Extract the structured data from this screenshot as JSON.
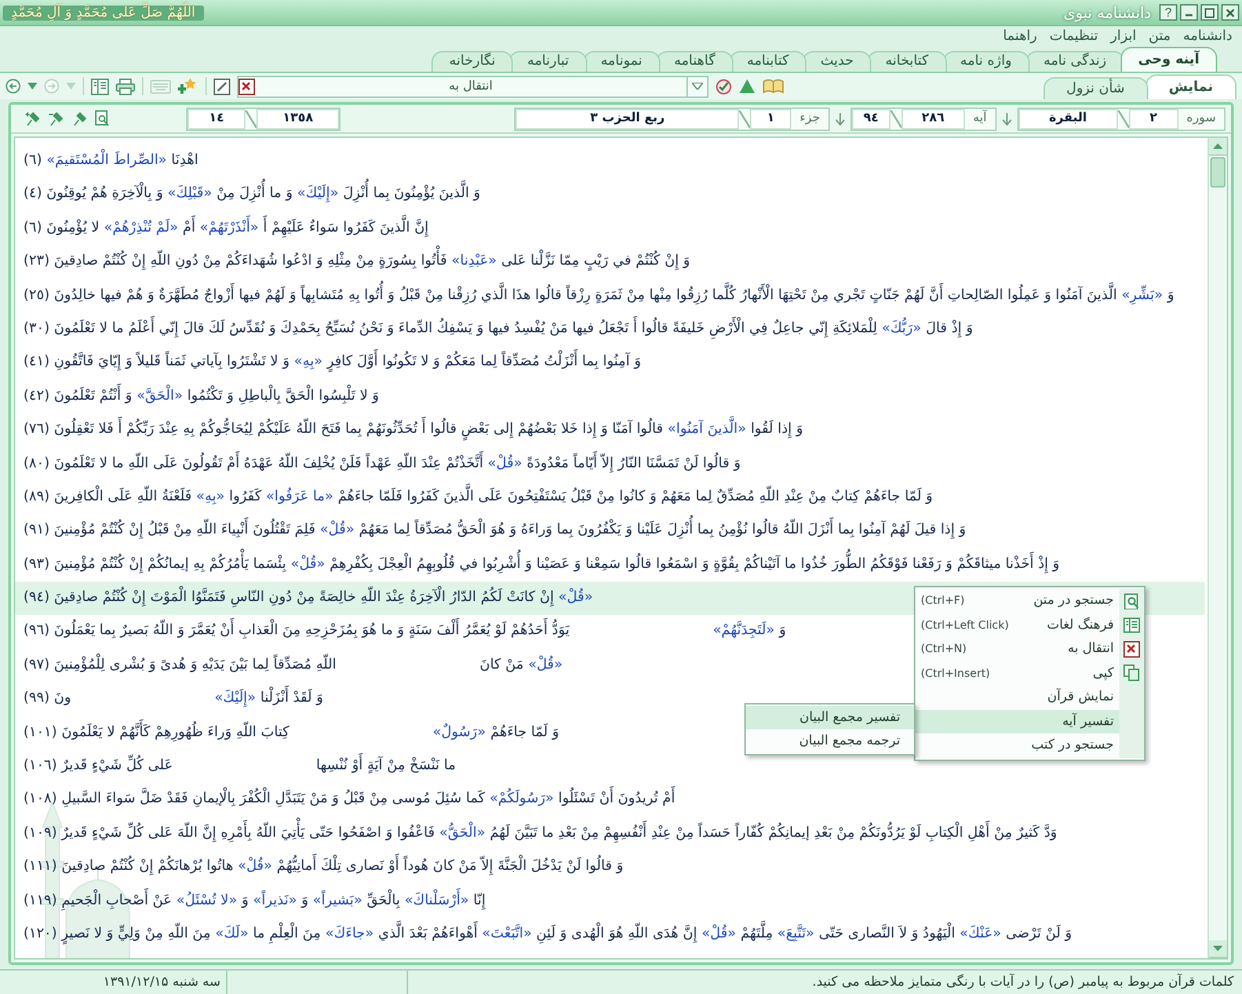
{
  "window": {
    "title": "دانشنامه نبوی",
    "calligraphy": "اللّهُمَّ صَلِّ عَلى مُحَمَّدٍ وَ آلِ مُحَمَّدٍ",
    "help_button": "?"
  },
  "menu": [
    "دانشنامه",
    "متن",
    "ابزار",
    "تنظیمات",
    "راهنما"
  ],
  "tabs": [
    {
      "label": "آینه وحی",
      "selected": true
    },
    {
      "label": "زندگی نامه",
      "selected": false
    },
    {
      "label": "واژه نامه",
      "selected": false
    },
    {
      "label": "کتابخانه",
      "selected": false
    },
    {
      "label": "حدیث",
      "selected": false
    },
    {
      "label": "کتابنامه",
      "selected": false
    },
    {
      "label": "گاهنامه",
      "selected": false
    },
    {
      "label": "نمونامه",
      "selected": false
    },
    {
      "label": "تبارنامه",
      "selected": false
    },
    {
      "label": "نگارخانه",
      "selected": false
    }
  ],
  "subtabs": [
    {
      "label": "نمایش",
      "selected": true
    },
    {
      "label": "شأن نزول",
      "selected": false
    }
  ],
  "toolbar": {
    "goto_combo": "انتقال به"
  },
  "nav": {
    "sura_label": "سوره",
    "sura_number": "٢",
    "sura_name": "البقرة",
    "aya_label": "آیه",
    "aya_total": "٢٨٦",
    "aya_current": "٩٤",
    "juz_label": "جزء",
    "juz_number": "١",
    "hizb": "ربع الحزب ٣",
    "page_total": "١٣٥٨",
    "page_current": "١٤"
  },
  "verses": [
    {
      "kind": "full",
      "selected": false,
      "segments": [
        {
          "text": "اهْدِنَا",
          "highlight": false
        },
        {
          "text": "«الصِّراطَ الْمُسْتَقيمَ»",
          "highlight": true
        },
        {
          "text": "(٦)",
          "highlight": false
        }
      ]
    },
    {
      "kind": "full",
      "selected": false,
      "segments": [
        {
          "text": "وَ الَّذينَ يُؤْمِنُونَ بِما أُنْزِلَ",
          "highlight": false
        },
        {
          "text": "«إِلَيْكَ»",
          "highlight": true
        },
        {
          "text": "وَ ما أُنْزِلَ مِنْ",
          "highlight": false
        },
        {
          "text": "«قَبْلِكَ»",
          "highlight": true
        },
        {
          "text": "وَ بِالْآخِرَةِ هُمْ يُوقِنُونَ (٤)",
          "highlight": false
        }
      ]
    },
    {
      "kind": "full",
      "selected": false,
      "segments": [
        {
          "text": "إِنَّ الَّذينَ كَفَرُوا سَواءٌ عَلَيْهِمْ أَ",
          "highlight": false
        },
        {
          "text": "«أَنْذَرْتَهُمْ»",
          "highlight": true
        },
        {
          "text": "أَمْ",
          "highlight": false
        },
        {
          "text": "«لَمْ تُنْذِرْهُمْ»",
          "highlight": true
        },
        {
          "text": "لا يُؤْمِنُونَ (٦)",
          "highlight": false
        }
      ]
    },
    {
      "kind": "full",
      "selected": false,
      "segments": [
        {
          "text": "وَ إِنْ كُنْتُمْ في رَيْبٍ مِمّا نَزَّلْنا عَلى",
          "highlight": false
        },
        {
          "text": "«عَبْدِنا»",
          "highlight": true
        },
        {
          "text": "فَأْتُوا بِسُورَةٍ مِنْ مِثْلِهِ وَ ادْعُوا شُهَداءَكُمْ مِنْ دُونِ اللّهِ إِنْ كُنْتُمْ صادِقينَ (٢٣)",
          "highlight": false
        }
      ]
    },
    {
      "kind": "full",
      "selected": false,
      "segments": [
        {
          "text": "وَ",
          "highlight": false
        },
        {
          "text": "«بَشِّرِ»",
          "highlight": true
        },
        {
          "text": "الَّذينَ آمَنُوا وَ عَمِلُوا الصّالِحاتِ أَنَّ لَهُمْ جَنّاتٍ تَجْري مِنْ تَحْتِهَا الْأَنْهارُ كُلَّما رُزِقُوا مِنْها مِنْ ثَمَرَةٍ رِزْقاً قالُوا هذَا الَّذي رُزِقْنا مِنْ قَبْلُ وَ أُتُوا بِهِ مُتَشابِهاً وَ لَهُمْ فيها أَزْواجٌ مُطَهَّرَةٌ وَ هُمْ فيها خالِدُونَ (٢٥)",
          "highlight": false
        }
      ]
    },
    {
      "kind": "full",
      "selected": false,
      "segments": [
        {
          "text": "وَ إِذْ قالَ",
          "highlight": false
        },
        {
          "text": "«رَبُّكَ»",
          "highlight": true
        },
        {
          "text": "لِلْمَلائِكَةِ إِنّي جاعِلٌ فِي الْأَرْضِ خَليفَةً قالُوا أَ تَجْعَلُ فيها مَنْ يُفْسِدُ فيها وَ يَسْفِكُ الدِّماءَ وَ نَحْنُ نُسَبِّحُ بِحَمْدِكَ وَ نُقَدِّسُ لَكَ قالَ إِنّي أَعْلَمُ ما لا تَعْلَمُونَ (٣٠)",
          "highlight": false
        }
      ]
    },
    {
      "kind": "full",
      "selected": false,
      "segments": [
        {
          "text": "وَ آمِنُوا بِما أَنْزَلْتُ مُصَدِّقاً لِما مَعَكُمْ وَ لا تَكُونُوا أَوَّلَ كافِرٍ",
          "highlight": false
        },
        {
          "text": "«بِهِ»",
          "highlight": true
        },
        {
          "text": "وَ لا تَشْتَرُوا بِآياتي ثَمَناً قَليلاً وَ إِيّايَ فَاتَّقُونِ (٤١)",
          "highlight": false
        }
      ]
    },
    {
      "kind": "full",
      "selected": false,
      "segments": [
        {
          "text": "وَ لا تَلْبِسُوا الْحَقَّ بِالْباطِلِ وَ تَكْتُمُوا",
          "highlight": false
        },
        {
          "text": "«الْحَقَّ»",
          "highlight": true
        },
        {
          "text": "وَ أَنْتُمْ تَعْلَمُونَ (٤٢)",
          "highlight": false
        }
      ]
    },
    {
      "kind": "full",
      "selected": false,
      "segments": [
        {
          "text": "وَ إِذا لَقُوا",
          "highlight": false
        },
        {
          "text": "«الَّذينَ آمَنُوا»",
          "highlight": true
        },
        {
          "text": "قالُوا آمَنّا وَ إِذا خَلا بَعْضُهُمْ إِلى بَعْضٍ قالُوا أَ تُحَدِّثُونَهُمْ بِما فَتَحَ اللّهُ عَلَيْكُمْ لِيُحَاجُّوكُمْ بِهِ عِنْدَ رَبِّكُمْ أَ فَلا تَعْقِلُونَ (٧٦)",
          "highlight": false
        }
      ]
    },
    {
      "kind": "full",
      "selected": false,
      "segments": [
        {
          "text": "وَ قالُوا لَنْ تَمَسَّنَا النّارُ إِلاّ أَيّاماً مَعْدُودَةً",
          "highlight": false
        },
        {
          "text": "«قُلْ»",
          "highlight": true
        },
        {
          "text": "أَتَّخَذْتُمْ عِنْدَ اللّهِ عَهْداً فَلَنْ يُخْلِفَ اللّهُ عَهْدَهُ أَمْ تَقُولُونَ عَلَى اللّهِ ما لا تَعْلَمُونَ (٨٠)",
          "highlight": false
        }
      ]
    },
    {
      "kind": "full",
      "selected": false,
      "segments": [
        {
          "text": "وَ لَمّا جاءَهُمْ كِتابٌ مِنْ عِنْدِ اللّهِ مُصَدِّقٌ لِما مَعَهُمْ وَ كانُوا مِنْ قَبْلُ يَسْتَفْتِحُونَ عَلَى الَّذينَ كَفَرُوا فَلَمّا جاءَهُمْ",
          "highlight": false
        },
        {
          "text": "«ما عَرَفُوا»",
          "highlight": true
        },
        {
          "text": "كَفَرُوا",
          "highlight": false
        },
        {
          "text": "«بِهِ»",
          "highlight": true
        },
        {
          "text": "فَلَعْنَةُ اللّهِ عَلَى الْكافِرينَ (٨٩)",
          "highlight": false
        }
      ]
    },
    {
      "kind": "full",
      "selected": false,
      "segments": [
        {
          "text": "وَ إِذا قيلَ لَهُمْ آمِنُوا بِما أَنْزَلَ اللّهُ قالُوا نُؤْمِنُ بِما أُنْزِلَ عَلَيْنا وَ يَكْفُرُونَ بِما وَراءَهُ وَ هُوَ الْحَقُّ مُصَدِّقاً لِما مَعَهُمْ",
          "highlight": false
        },
        {
          "text": "«قُلْ»",
          "highlight": true
        },
        {
          "text": "فَلِمَ تَقْتُلُونَ أَنْبِياءَ اللّهِ مِنْ قَبْلُ إِنْ كُنْتُمْ مُؤْمِنينَ (٩١)",
          "highlight": false
        }
      ]
    },
    {
      "kind": "full",
      "selected": false,
      "segments": [
        {
          "text": "وَ إِذْ أَخَذْنا ميثاقَكُمْ وَ رَفَعْنا فَوْقَكُمُ الطُّورَ خُذُوا ما آتَيْناكُمْ بِقُوَّةٍ وَ اسْمَعُوا قالُوا سَمِعْنا وَ عَصَيْنا وَ أُشْرِبُوا في قُلُوبِهِمُ الْعِجْلَ بِكُفْرِهِمْ",
          "highlight": false
        },
        {
          "text": "«قُلْ»",
          "highlight": true
        },
        {
          "text": "بِئْسَما يَأْمُرُكُمْ بِهِ إيمانُكُمْ إِنْ كُنْتُمْ مُؤْمِنينَ (٩٣)",
          "highlight": false
        }
      ]
    },
    {
      "kind": "full",
      "selected": true,
      "segments": [
        {
          "text": "«قُلْ»",
          "highlight": true
        },
        {
          "text": "إِنْ كانَتْ لَكُمُ الدّارُ الْآخِرَةُ عِنْدَ اللّهِ خالِصَةً مِنْ دُونِ النّاسِ فَتَمَنَّوُا الْمَوْتَ إِنْ كُنْتُمْ صادِقينَ (٩٤)",
          "highlight": false
        }
      ]
    },
    {
      "kind": "covered",
      "selected": false,
      "start": [
        {
          "text": "وَ",
          "highlight": false
        },
        {
          "text": "«لَتَجِدَنَّهُمْ»",
          "highlight": true
        }
      ],
      "end": [
        {
          "text": "يَوَدُّ أَحَدُهُمْ لَوْ يُعَمَّرُ أَلْفَ سَنَةٍ وَ ما هُوَ بِمُزَحْزِحِهِ مِنَ الْعَذابِ أَنْ يُعَمَّرَ وَ اللّهُ بَصيرٌ بِما يَعْمَلُونَ (٩٦)",
          "highlight": false
        }
      ]
    },
    {
      "kind": "covered",
      "selected": false,
      "start": [
        {
          "text": "«قُلْ»",
          "highlight": true
        },
        {
          "text": "مَنْ كانَ",
          "highlight": false
        }
      ],
      "end": [
        {
          "text": "اللّهِ مُصَدِّقاً لِما بَيْنَ يَدَيْهِ وَ هُدىً وَ بُشْرى لِلْمُؤْمِنينَ (٩٧)",
          "highlight": false
        }
      ]
    },
    {
      "kind": "covered",
      "selected": false,
      "start": [
        {
          "text": "وَ لَقَدْ أَنْزَلْنا",
          "highlight": false
        },
        {
          "text": "«إِلَيْكَ»",
          "highlight": true
        }
      ],
      "end": [
        {
          "text": "ونَ (٩٩)",
          "highlight": false
        }
      ]
    },
    {
      "kind": "covered",
      "selected": false,
      "start": [
        {
          "text": "وَ لَمّا جاءَهُمْ",
          "highlight": false
        },
        {
          "text": "«رَسُولٌ»",
          "highlight": true
        }
      ],
      "end": [
        {
          "text": "كِتابَ اللّهِ وَراءَ ظُهُورِهِمْ كَأَنَّهُمْ لا يَعْلَمُونَ (١٠١)",
          "highlight": false
        }
      ]
    },
    {
      "kind": "covered",
      "selected": false,
      "start": [
        {
          "text": "ما نَنْسَخْ مِنْ آيَةٍ أَوْ نُنْسِها",
          "highlight": false
        }
      ],
      "end": [
        {
          "text": "عَلى كُلِّ شَيْءٍ قَديرٌ (١٠٦)",
          "highlight": false
        }
      ]
    },
    {
      "kind": "full",
      "selected": false,
      "segments": [
        {
          "text": "أَمْ تُريدُونَ أَنْ تَسْئَلُوا",
          "highlight": false
        },
        {
          "text": "«رَسُولَكُمْ»",
          "highlight": true
        },
        {
          "text": "كَما سُئِلَ مُوسى مِنْ قَبْلُ وَ مَنْ يَتَبَدَّلِ الْكُفْرَ بِالْإيمانِ فَقَدْ ضَلَّ سَواءَ السَّبيلِ (١٠٨)",
          "highlight": false
        }
      ]
    },
    {
      "kind": "full",
      "selected": false,
      "segments": [
        {
          "text": "وَدَّ كَثيرٌ مِنْ أَهْلِ الْكِتابِ لَوْ يَرُدُّونَكُمْ مِنْ بَعْدِ إيمانِكُمْ كُفّاراً حَسَداً مِنْ عِنْدِ أَنْفُسِهِمْ مِنْ بَعْدِ ما تَبَيَّنَ لَهُمُ",
          "highlight": false
        },
        {
          "text": "«الْحَقُّ»",
          "highlight": true
        },
        {
          "text": "فَاعْفُوا وَ اصْفَحُوا حَتّى يَأْتِيَ اللّهُ بِأَمْرِهِ إِنَّ اللّهَ عَلى كُلِّ شَيْءٍ قَديرٌ (١٠٩)",
          "highlight": false
        }
      ]
    },
    {
      "kind": "full",
      "selected": false,
      "segments": [
        {
          "text": "وَ قالُوا لَنْ يَدْخُلَ الْجَنَّةَ إِلاّ مَنْ كانَ هُوداً أَوْ نَصارى تِلْكَ أَمانِيُّهُمْ",
          "highlight": false
        },
        {
          "text": "«قُلْ»",
          "highlight": true
        },
        {
          "text": "هاتُوا بُرْهانَكُمْ إِنْ كُنْتُمْ صادِقينَ (١١١)",
          "highlight": false
        }
      ]
    },
    {
      "kind": "full",
      "selected": false,
      "segments": [
        {
          "text": "إِنّا",
          "highlight": false
        },
        {
          "text": "«أَرْسَلْناكَ»",
          "highlight": true
        },
        {
          "text": "بِالْحَقِّ",
          "highlight": false
        },
        {
          "text": "«بَشيراً»",
          "highlight": true
        },
        {
          "text": "وَ",
          "highlight": false
        },
        {
          "text": "«نَذيراً»",
          "highlight": true
        },
        {
          "text": "وَ",
          "highlight": false
        },
        {
          "text": "«لا تُسْئَلُ»",
          "highlight": true
        },
        {
          "text": "عَنْ أَصْحابِ الْجَحيمِ (١١٩)",
          "highlight": false
        }
      ]
    },
    {
      "kind": "full",
      "selected": false,
      "segments": [
        {
          "text": "وَ لَنْ تَرْضى",
          "highlight": false
        },
        {
          "text": "«عَنْكَ»",
          "highlight": true
        },
        {
          "text": "الْيَهُودُ وَ لاَ النَّصارى حَتّى",
          "highlight": false
        },
        {
          "text": "«تَتَّبِعَ»",
          "highlight": true
        },
        {
          "text": "مِلَّتَهُمْ",
          "highlight": false
        },
        {
          "text": "«قُلْ»",
          "highlight": true
        },
        {
          "text": "إِنَّ هُدَى اللّهِ هُوَ الْهُدى وَ لَئِنِ",
          "highlight": false
        },
        {
          "text": "«اتَّبَعْتَ»",
          "highlight": true
        },
        {
          "text": "أَهْواءَهُمْ بَعْدَ الَّذي",
          "highlight": false
        },
        {
          "text": "«جاءَكَ»",
          "highlight": true
        },
        {
          "text": "مِنَ الْعِلْمِ ما",
          "highlight": false
        },
        {
          "text": "«لَكَ»",
          "highlight": true
        },
        {
          "text": "مِنَ اللّهِ مِنْ وَلِيٍّ وَ لا نَصيرٍ (١٢٠)",
          "highlight": false
        }
      ]
    }
  ],
  "context_menu": {
    "items": [
      {
        "label": "جستجو در متن",
        "shortcut": "(Ctrl+F)",
        "selected": false
      },
      {
        "label": "فرهنگ لغات",
        "shortcut": "(Ctrl+Left Click)",
        "selected": false
      },
      {
        "label": "انتقال به",
        "shortcut": "(Ctrl+N)",
        "selected": false
      },
      {
        "label": "کپی",
        "shortcut": "(Ctrl+Insert)",
        "selected": false
      },
      {
        "label": "نمایش قرآن",
        "selected": false
      },
      {
        "label": "تفسیر آیه",
        "selected": true
      },
      {
        "label": "جستجو در کتب",
        "selected": false
      }
    ],
    "submenu": [
      {
        "label": "تفسیر مجمع البیان",
        "selected": true
      },
      {
        "label": "ترجمه مجمع البیان",
        "selected": false
      }
    ]
  },
  "status_bar": {
    "message": "کلمات قرآن مربوط به پیامبر (ص) را در آیات با رنگی متمایز ملاحظه می کنید.",
    "date": "سه شنبه ۱۳۹۱/۱۲/۱۵"
  }
}
